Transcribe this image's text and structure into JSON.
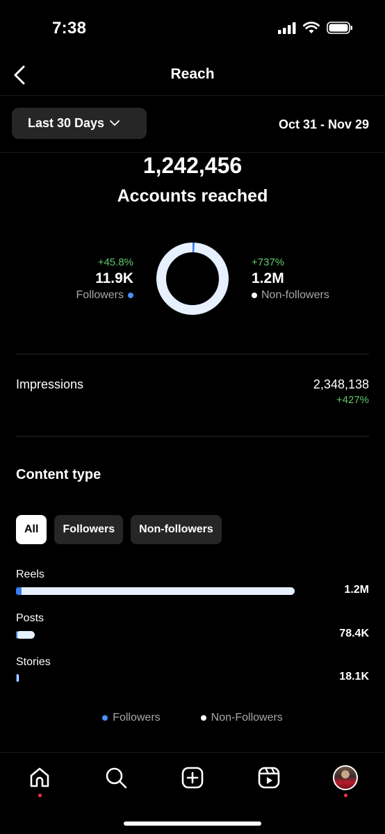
{
  "status_bar": {
    "time": "7:38"
  },
  "header": {
    "title": "Reach"
  },
  "filter": {
    "range_label": "Last 30 Days",
    "date_range": "Oct 31 - Nov 29"
  },
  "summary": {
    "accounts_reached": "1,242,456",
    "accounts_label": "Accounts reached",
    "followers": {
      "change": "+45.8%",
      "value": "11.9K",
      "label": "Followers"
    },
    "non_followers": {
      "change": "+737%",
      "value": "1.2M",
      "label": "Non-followers"
    },
    "donut_follower_fraction": 0.0096
  },
  "impressions": {
    "label": "Impressions",
    "value": "2,348,138",
    "change": "+427%"
  },
  "content_type": {
    "title": "Content type",
    "chips": [
      {
        "label": "All",
        "active": true
      },
      {
        "label": "Followers",
        "active": false
      },
      {
        "label": "Non-followers",
        "active": false
      }
    ],
    "rows": [
      {
        "label": "Reels",
        "value": "1.2M",
        "total_fraction": 1.0,
        "follower_fraction": 0.02
      },
      {
        "label": "Posts",
        "value": "78.4K",
        "total_fraction": 0.068,
        "follower_fraction": 0.006
      },
      {
        "label": "Stories",
        "value": "18.1K",
        "total_fraction": 0.01,
        "follower_fraction": 0.005
      }
    ],
    "legend": {
      "followers": "Followers",
      "non_followers": "Non-Followers"
    }
  },
  "colors": {
    "followers": "#3a7bf0",
    "non_followers": "#e6f0ff",
    "positive": "#5fc96b",
    "notification": "#ff3040"
  },
  "tabbar": {
    "tabs": [
      {
        "icon": "home-icon"
      },
      {
        "icon": "search-icon"
      },
      {
        "icon": "create-icon"
      },
      {
        "icon": "reels-icon"
      },
      {
        "icon": "profile-avatar"
      }
    ]
  }
}
